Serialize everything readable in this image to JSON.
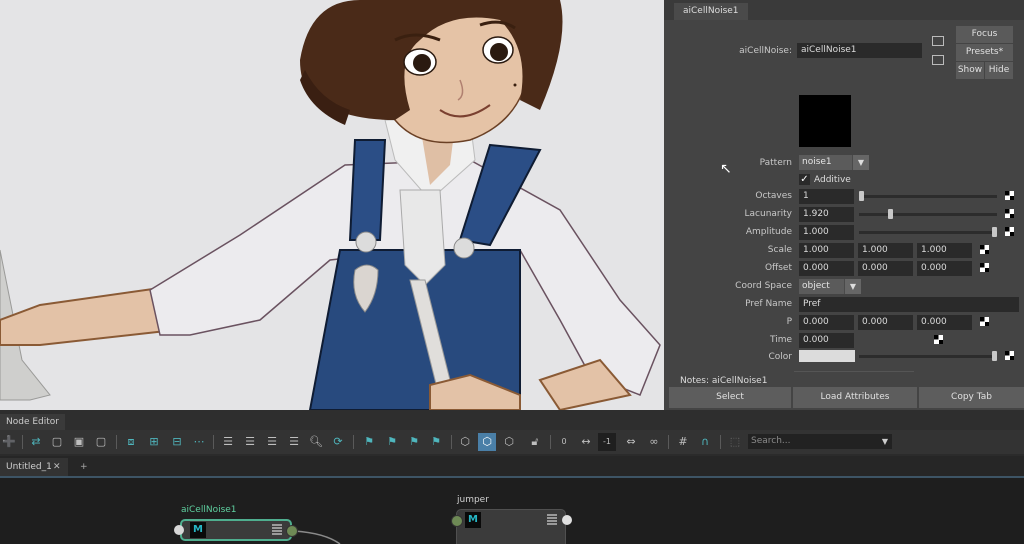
{
  "attribute_editor": {
    "tab": "aiCellNoise1",
    "node_label": "aiCellNoise:",
    "node_name": "aiCellNoise1",
    "buttons": {
      "focus": "Focus",
      "presets": "Presets*",
      "show": "Show",
      "hide": "Hide"
    },
    "swatch_color": "#000000",
    "pattern": {
      "label": "Pattern",
      "value": "noise1"
    },
    "additive": {
      "label": "Additive",
      "checked": true
    },
    "octaves": {
      "label": "Octaves",
      "value": "1",
      "slider": 0.0
    },
    "lacunarity": {
      "label": "Lacunarity",
      "value": "1.920",
      "slider": 0.22
    },
    "amplitude": {
      "label": "Amplitude",
      "value": "1.000",
      "slider": 1.0
    },
    "scale": {
      "label": "Scale",
      "values": [
        "1.000",
        "1.000",
        "1.000"
      ]
    },
    "offset": {
      "label": "Offset",
      "values": [
        "0.000",
        "0.000",
        "0.000"
      ]
    },
    "coord_space": {
      "label": "Coord Space",
      "value": "object"
    },
    "pref_name": {
      "label": "Pref Name",
      "value": "Pref"
    },
    "p": {
      "label": "P",
      "values": [
        "0.000",
        "0.000",
        "0.000"
      ]
    },
    "time": {
      "label": "Time",
      "value": "0.000"
    },
    "color": {
      "label": "Color",
      "value": "#dcdcdc",
      "slider": 1.0
    },
    "notes": "Notes:  aiCellNoise1",
    "bottom_buttons": {
      "select": "Select",
      "load_attributes": "Load Attributes",
      "copy_tab": "Copy Tab"
    }
  },
  "node_editor": {
    "title": "Node Editor",
    "search_placeholder": "Search...",
    "frame_value": "-1",
    "zero_label": "0",
    "tabs": [
      {
        "label": "Untitled_1",
        "close": "✕"
      }
    ],
    "add_tab": "+",
    "nodes": [
      {
        "name": "aiCellNoise1",
        "icon": "M",
        "selected": true
      },
      {
        "name": "jumper",
        "icon": "M",
        "selected": false
      }
    ]
  },
  "colors": {
    "accent_selected": "#4fae8f",
    "node_label_selected": "#5fd0a0",
    "toolbar_active": "#4a7fa7",
    "teal_icon": "#4fb6bd"
  }
}
